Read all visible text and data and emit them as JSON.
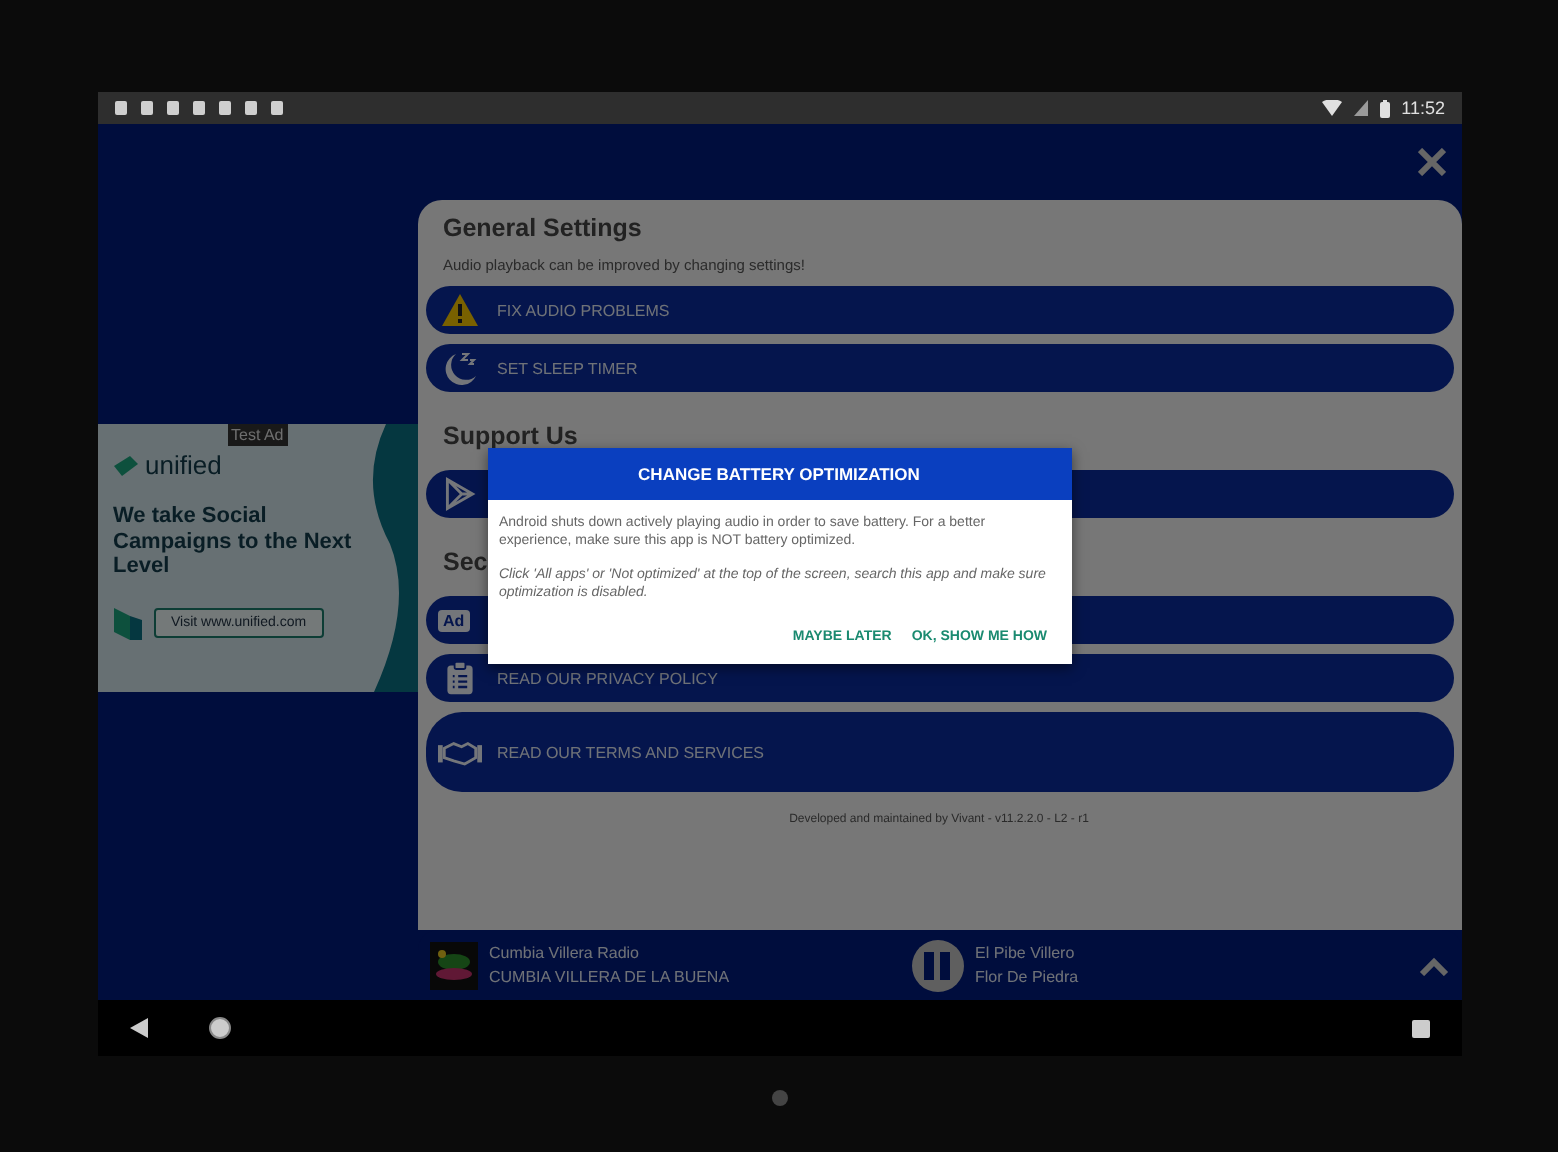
{
  "status_bar": {
    "time": "11:52"
  },
  "ad": {
    "badge": "Test Ad",
    "brand": "unified",
    "headline": "We take Social Campaigns to the Next Level",
    "cta": "Visit www.unified.com"
  },
  "sections": [
    {
      "title": "General Settings",
      "subtitle": "Audio playback can be improved by changing settings!",
      "items": [
        {
          "kind": "warning",
          "label": "FIX AUDIO PROBLEMS",
          "tall": false
        },
        {
          "kind": "sleep",
          "label": "SET SLEEP TIMER",
          "tall": false
        }
      ]
    },
    {
      "title": "Support Us",
      "items": [
        {
          "kind": "store",
          "tall": false
        }
      ]
    },
    {
      "title": "Sec",
      "items": [
        {
          "kind": "ad",
          "icon_text": "Ad",
          "tall": false
        },
        {
          "kind": "privacy",
          "label": "READ OUR PRIVACY POLICY",
          "tall": false
        },
        {
          "kind": "terms",
          "label": "READ OUR TERMS AND SERVICES",
          "tall": true
        }
      ]
    }
  ],
  "footer": "Developed and maintained by Vivant - v11.2.2.0 - L2 - r1",
  "dialog": {
    "title": "CHANGE BATTERY OPTIMIZATION",
    "paragraphs": [
      "Android shuts down actively playing audio in order to save battery. For a better experience, make sure this app is NOT battery optimized.",
      "*Click 'All apps' or 'Not optimized' at the top of the screen, search this app and make sure optimization is disabled.*"
    ],
    "buttons": [
      "MAYBE LATER",
      "OK, SHOW ME HOW"
    ]
  },
  "player": {
    "station": "Cumbia Villera Radio",
    "station_subtitle": "CUMBIA VILLERA DE LA BUENA",
    "playing": true,
    "track": "El Pibe Villero",
    "artist": "Flor De Piedra"
  }
}
